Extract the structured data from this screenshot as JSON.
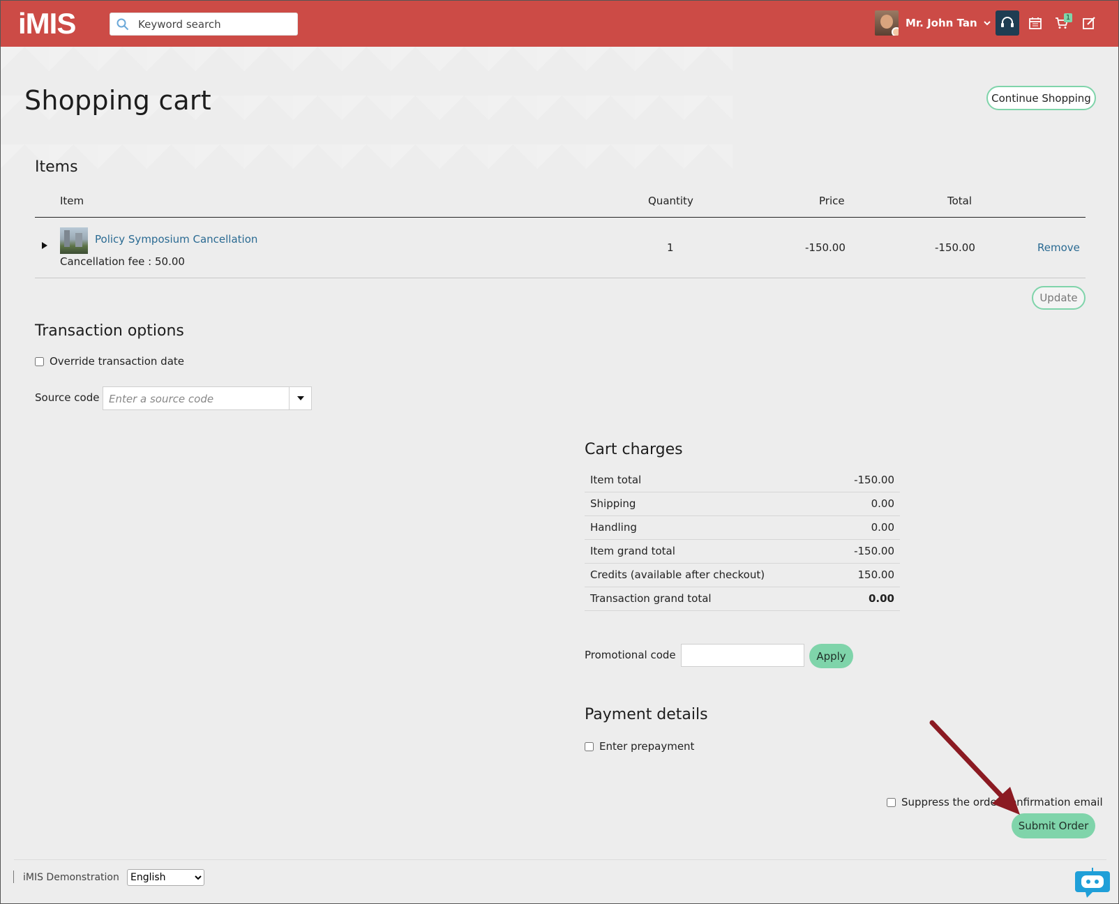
{
  "header": {
    "logo": "iMIS",
    "search_placeholder": "Keyword search",
    "user_name": "Mr. John Tan",
    "cart_count": "1",
    "colors": {
      "brand": "#cc4b46",
      "accent": "#7fd4aa",
      "link": "#2a6a92",
      "support_bg": "#1f3d52"
    },
    "icons": [
      "search-icon",
      "chevron-down-icon",
      "headset-icon",
      "calendar-icon",
      "cart-icon",
      "edit-icon"
    ]
  },
  "page": {
    "title": "Shopping cart",
    "continue_label": "Continue Shopping"
  },
  "items": {
    "heading": "Items",
    "columns": {
      "item": "Item",
      "quantity": "Quantity",
      "price": "Price",
      "total": "Total"
    },
    "rows": [
      {
        "name": "Policy Symposium Cancellation",
        "detail": "Cancellation fee : 50.00",
        "quantity": "1",
        "price": "-150.00",
        "total": "-150.00",
        "remove_label": "Remove"
      }
    ],
    "update_label": "Update"
  },
  "transaction": {
    "heading": "Transaction options",
    "override_label": "Override transaction date",
    "override_checked": false,
    "source_label": "Source code",
    "source_placeholder": "Enter a source code"
  },
  "cart_charges": {
    "heading": "Cart charges",
    "rows": [
      {
        "label": "Item total",
        "value": "-150.00"
      },
      {
        "label": "Shipping",
        "value": "0.00"
      },
      {
        "label": "Handling",
        "value": "0.00"
      },
      {
        "label": "Item grand total",
        "value": "-150.00"
      },
      {
        "label": "Credits (available after checkout)",
        "value": "150.00"
      },
      {
        "label": "Transaction grand total",
        "value": "0.00"
      }
    ],
    "promo_label": "Promotional code",
    "promo_value": "",
    "apply_label": "Apply"
  },
  "payment": {
    "heading": "Payment details",
    "prepay_label": "Enter prepayment",
    "prepay_checked": false,
    "suppress_label": "Suppress the order confirmation email",
    "suppress_checked": false,
    "submit_label": "Submit Order"
  },
  "footer": {
    "site_name": "iMIS Demonstration",
    "language_selected": "English"
  },
  "annotation": {
    "arrow_color": "#8b1a22"
  }
}
